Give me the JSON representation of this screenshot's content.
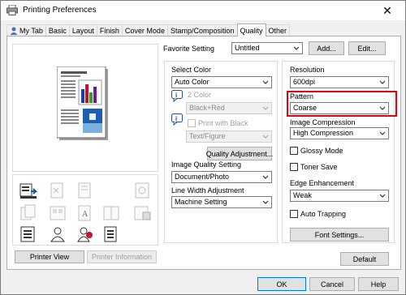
{
  "window": {
    "title": "Printing Preferences",
    "close_glyph": "✕"
  },
  "tabs": [
    {
      "label": "My Tab"
    },
    {
      "label": "Basic"
    },
    {
      "label": "Layout"
    },
    {
      "label": "Finish"
    },
    {
      "label": "Cover Mode"
    },
    {
      "label": "Stamp/Composition"
    },
    {
      "label": "Quality"
    },
    {
      "label": "Other"
    }
  ],
  "favorite": {
    "label": "Favorite Setting",
    "value": "Untitled",
    "add_label": "Add...",
    "edit_label": "Edit..."
  },
  "select_color": {
    "label": "Select Color",
    "value": "Auto Color"
  },
  "two_color": {
    "label": "2 Color",
    "value": "Black+Red"
  },
  "print_with_black": {
    "label": "Print with Black",
    "value": "Text/Figure"
  },
  "quality_adjustment": {
    "label": "Quality Adjustment..."
  },
  "image_quality": {
    "label": "Image Quality Setting",
    "value": "Document/Photo"
  },
  "line_width": {
    "label": "Line Width Adjustment",
    "value": "Machine Setting"
  },
  "resolution": {
    "label": "Resolution",
    "value": "600dpi"
  },
  "pattern": {
    "label": "Pattern",
    "value": "Coarse"
  },
  "image_compression": {
    "label": "Image Compression",
    "value": "High Compression"
  },
  "glossy_mode": {
    "label": "Glossy Mode",
    "checked": false
  },
  "toner_save": {
    "label": "Toner Save",
    "checked": false
  },
  "edge_enhancement": {
    "label": "Edge Enhancement",
    "value": "Weak"
  },
  "auto_trapping": {
    "label": "Auto Trapping",
    "checked": false
  },
  "font_settings": {
    "label": "Font Settings..."
  },
  "default_button": {
    "label": "Default"
  },
  "printer_view": {
    "label": "Printer View"
  },
  "printer_information": {
    "label": "Printer Information"
  },
  "footer": {
    "ok": "OK",
    "cancel": "Cancel",
    "help": "Help"
  },
  "colors": {
    "highlight": "#e3000f",
    "accent": "#0078d7"
  }
}
